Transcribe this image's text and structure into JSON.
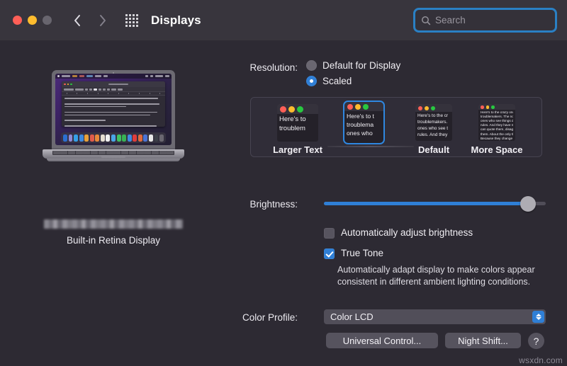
{
  "window": {
    "title": "Displays",
    "traffic_lights": [
      "close",
      "minimize",
      "zoom-disabled"
    ],
    "nav": {
      "back": "back-chevron",
      "forward": "forward-chevron",
      "show_all": "show-all-grid"
    }
  },
  "search": {
    "placeholder": "Search",
    "value": "",
    "icon": "search-icon",
    "focus_color": "#2a80c4"
  },
  "display_preview": {
    "device": "macbook-illustration",
    "redacted_label": "",
    "name": "Built-in Retina Display",
    "desktop_text_lines": [
      "Here's to the crazy ones. The misfits. The rebels. The troublemakers. The round pegs in the square holes.",
      "The ones who see things differently. They're not fond of rules. And they have no respect for the status quo.",
      "You can quote them, disagree with them, glorify or vilify them.",
      "But the only thing you can't do is ignore them. Because they change things. They invent. They imagine.",
      "They heal. They explore. They create. They inspire. They push the human race forward.",
      "Maybe they have to be crazy.",
      "How else can you stare at an empty canvas and see a work of art? Or sit in silence and hear a song",
      "never been written? Or gaze at a red planet and see a laboratory on wheels?",
      "We make tools for these kinds of people.",
      "While some may see them as the crazy ones, we see genius. Because the people who are crazy enough",
      "to think they can change the world, are the ones who do."
    ]
  },
  "resolution": {
    "label": "Resolution:",
    "options": [
      {
        "label": "Default for Display",
        "selected": false
      },
      {
        "label": "Scaled",
        "selected": true
      }
    ],
    "scaled_choices": [
      {
        "label": "Larger Text",
        "selected": false,
        "lines": [
          "Here's to",
          "troublem"
        ]
      },
      {
        "label": "",
        "selected": true,
        "lines": [
          "Here's to t",
          "troublema",
          "ones who"
        ]
      },
      {
        "label": "Default",
        "selected": false,
        "lines": [
          "Here's to the cr",
          "troublemakers.",
          "ones who see t",
          "rules. And they"
        ]
      },
      {
        "label": "More Space",
        "selected": false,
        "lines": [
          "Here's to the crazy one",
          "troublemakers. The nou",
          "ones who see things dif",
          "rules. And they have no",
          "can quote them, disagre",
          "them. About the only th",
          "Because they change th"
        ]
      }
    ]
  },
  "brightness": {
    "label": "Brightness:",
    "value_percent": 92,
    "accent_color": "#2f7fd6"
  },
  "auto_brightness": {
    "label": "Automatically adjust brightness",
    "checked": false
  },
  "true_tone": {
    "label": "True Tone",
    "checked": true,
    "description": "Automatically adapt display to make colors appear consistent in different ambient lighting conditions."
  },
  "color_profile": {
    "label": "Color Profile:",
    "selected": "Color LCD",
    "options": [
      "Color LCD"
    ]
  },
  "buttons": {
    "universal_control": "Universal Control...",
    "night_shift": "Night Shift...",
    "help": "?"
  },
  "watermark": "wsxdn.com",
  "dock_icon_colors": [
    "#2b6fd1",
    "#8e8bd6",
    "#35a0e8",
    "#3f8ae0",
    "#e8a13a",
    "#e05b4a",
    "#e8883a",
    "#e6dfd2",
    "#f0f0f0",
    "#4aa5e8",
    "#3fc261",
    "#38b254",
    "#3f8ae0",
    "#e03c3c",
    "#e06a3c",
    "#4b74d6",
    "#e8e8e8",
    "#3c3f48",
    "#6a6770"
  ]
}
